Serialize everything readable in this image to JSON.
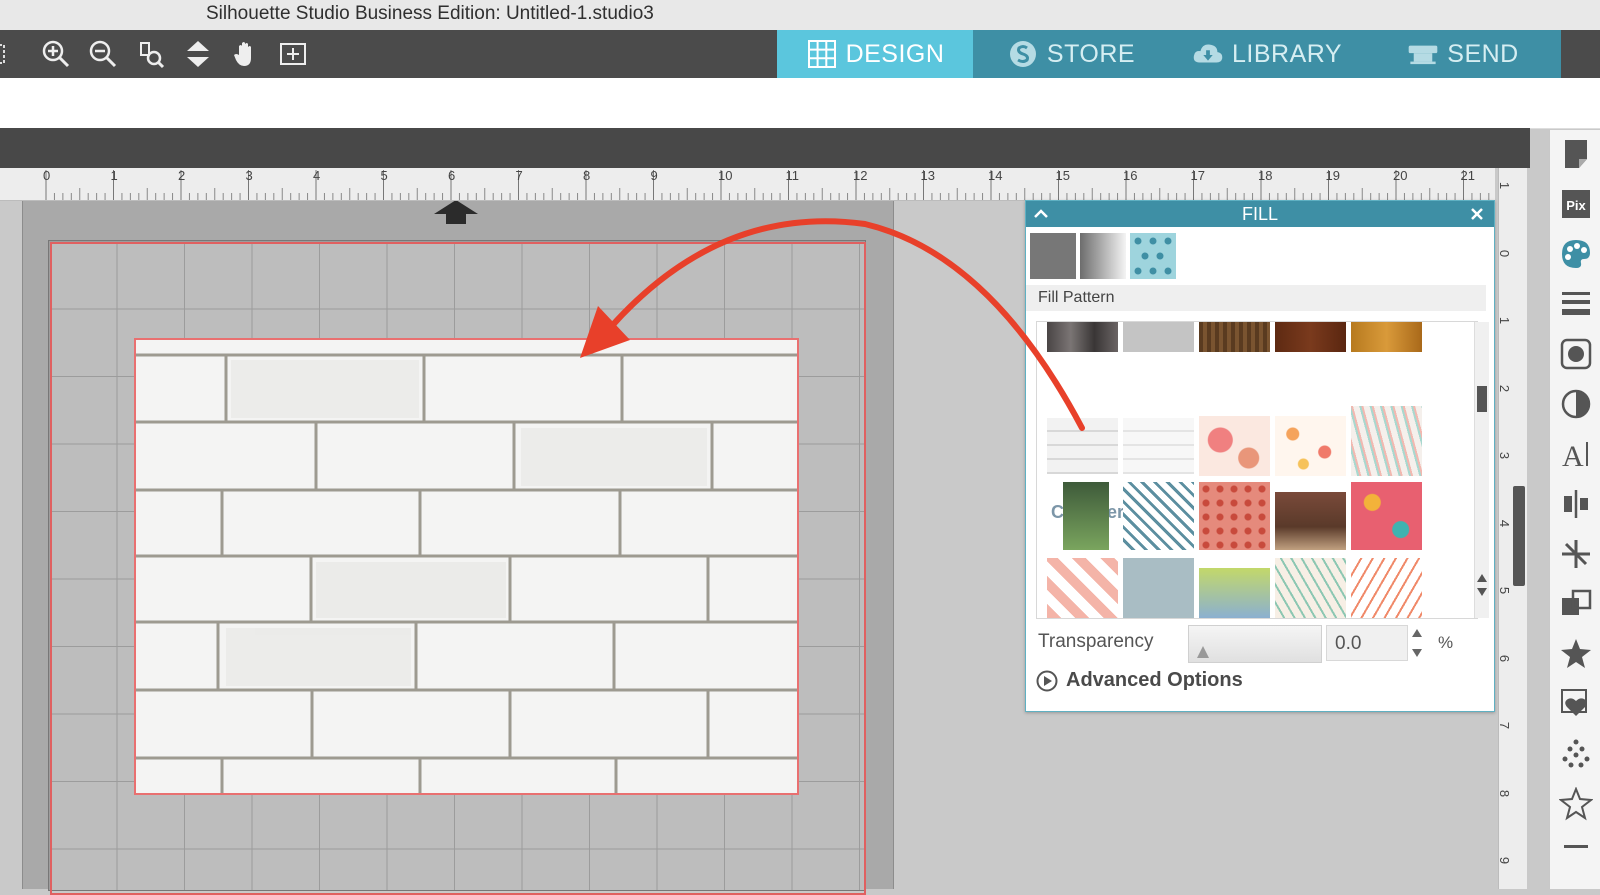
{
  "window": {
    "title": "Silhouette Studio Business Edition: Untitled-1.studio3"
  },
  "toolbar": {
    "tools": [
      "zoom-in-icon",
      "zoom-out-icon",
      "zoom-select-icon",
      "fit-to-page-icon",
      "pan-hand-icon",
      "add-page-icon"
    ]
  },
  "nav": {
    "tabs": [
      {
        "label": "DESIGN",
        "icon": "grid-icon",
        "active": true
      },
      {
        "label": "STORE",
        "icon": "silhouette-s-icon",
        "active": false
      },
      {
        "label": "LIBRARY",
        "icon": "cloud-download-icon",
        "active": false
      },
      {
        "label": "SEND",
        "icon": "cutter-icon",
        "active": false
      }
    ]
  },
  "ruler": {
    "horizontal": [
      "0",
      "1",
      "2",
      "3",
      "4",
      "5",
      "6",
      "7",
      "8",
      "9",
      "10",
      "11",
      "12",
      "13",
      "14",
      "15",
      "16",
      "17",
      "18",
      "19",
      "20",
      "21"
    ],
    "vertical": [
      "1",
      "0",
      "1",
      "2",
      "3",
      "4",
      "5",
      "6",
      "7",
      "8",
      "9"
    ]
  },
  "fill_panel": {
    "title": "FILL",
    "section_label": "Fill Pattern",
    "category_label": "Commercial use",
    "transparency_label": "Transparency",
    "transparency_value": "0.0",
    "transparency_unit": "%",
    "advanced_label": "Advanced Options"
  },
  "colors": {
    "accent": "#3e8fa5",
    "active_tab": "#5bc6dd",
    "toolbar": "#4b4b4b",
    "arrow": "#e8402a",
    "cut_line": "#e97070"
  }
}
